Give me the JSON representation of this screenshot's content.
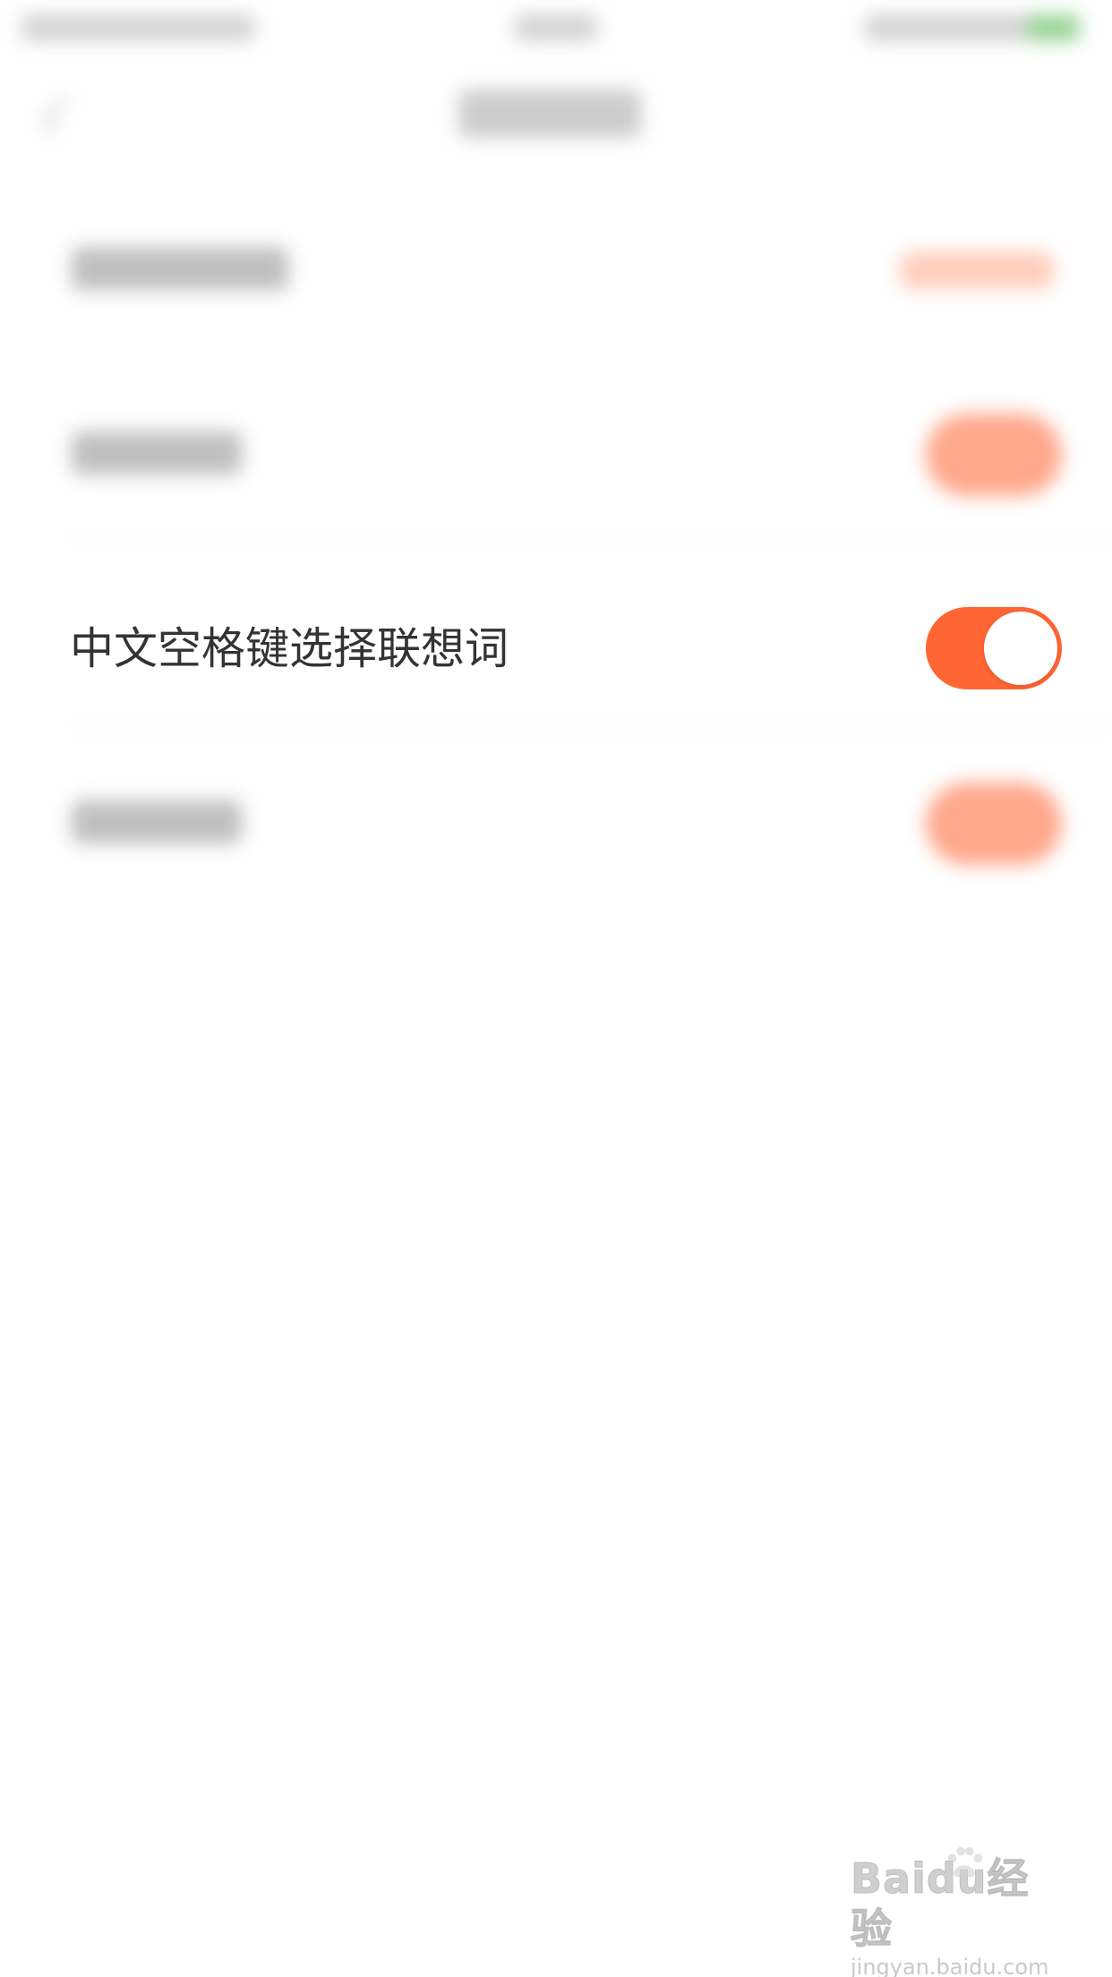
{
  "screen": {
    "title": "",
    "status_bar": {
      "left": "",
      "center": "",
      "right": ""
    }
  },
  "rows": [
    {
      "label": "",
      "kind": "value",
      "value": ""
    },
    {
      "label": "",
      "kind": "toggle",
      "state": true
    },
    {
      "label": "中文空格键选择联想词",
      "kind": "toggle",
      "state": true
    },
    {
      "label": "",
      "kind": "toggle",
      "state": true
    }
  ],
  "watermark": {
    "line1": "Baidu经验",
    "line2": "jingyan.baidu.com"
  },
  "colors": {
    "accent": "#ff6633",
    "text": "#333333",
    "background": "#ffffff"
  },
  "icons": {
    "back": "chevron-left-icon",
    "watermark": "paw-icon"
  }
}
